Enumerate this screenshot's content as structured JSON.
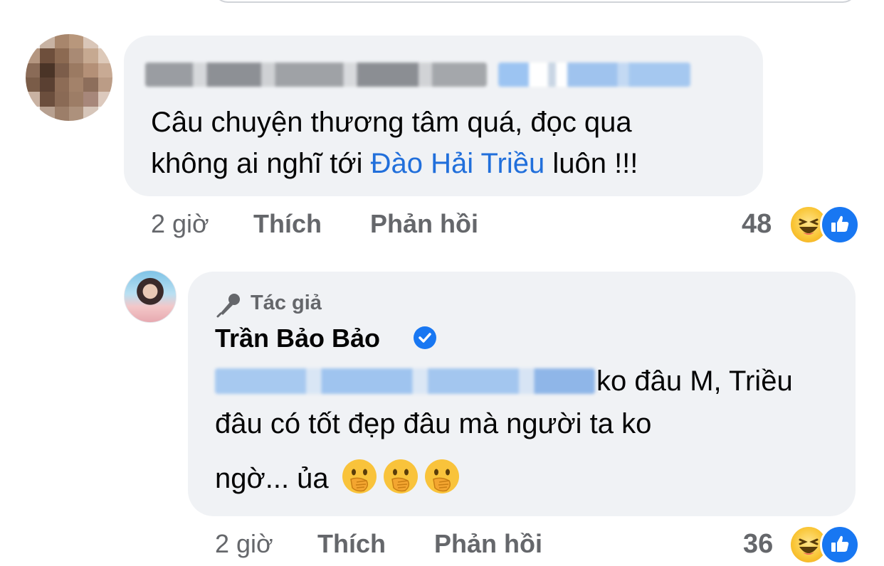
{
  "comment_1": {
    "text_before_mention": "Câu chuyện thương tâm quá, đọc qua",
    "text_line2_before": "không ai nghĩ tới ",
    "mention": "Đào Hải Triều",
    "text_line2_after": " luôn !!!",
    "time": "2 giờ",
    "like_label": "Thích",
    "reply_label": "Phản hồi",
    "reaction_count": "48",
    "reactions": [
      "haha-icon",
      "like-icon"
    ]
  },
  "comment_2": {
    "badge": "Tác giả",
    "author": "Trần Bảo Bảo",
    "line1_after_blur": "ko đâu M, Triều",
    "line2": "đâu có tốt đẹp đâu mà người ta ko",
    "line3": "ngờ... ủa",
    "emojis": [
      "face-with-hand-over-mouth-icon",
      "face-with-hand-over-mouth-icon",
      "face-with-hand-over-mouth-icon"
    ],
    "time": "2 giờ",
    "like_label": "Thích",
    "reply_label": "Phản hồi",
    "reaction_count": "36",
    "reactions": [
      "haha-icon",
      "like-icon"
    ]
  },
  "colors": {
    "bubble": "#f0f2f5",
    "mention": "#216fdb",
    "secondary_text": "#65676b",
    "like_blue": "#1877f2"
  }
}
